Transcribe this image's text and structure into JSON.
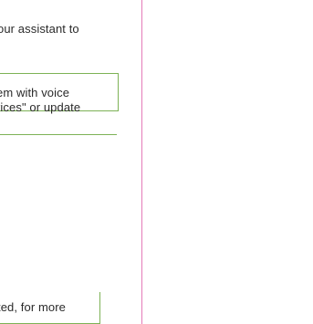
{
  "content": {
    "intro_fragment": "our assistant to",
    "card": {
      "line1": "em with voice",
      "line2": "rices\" or update"
    },
    "footer_fragment": "ted, for more"
  },
  "colors": {
    "card_border": "#7db256",
    "divider": "#e47ab8",
    "text": "#2a2a2a"
  }
}
